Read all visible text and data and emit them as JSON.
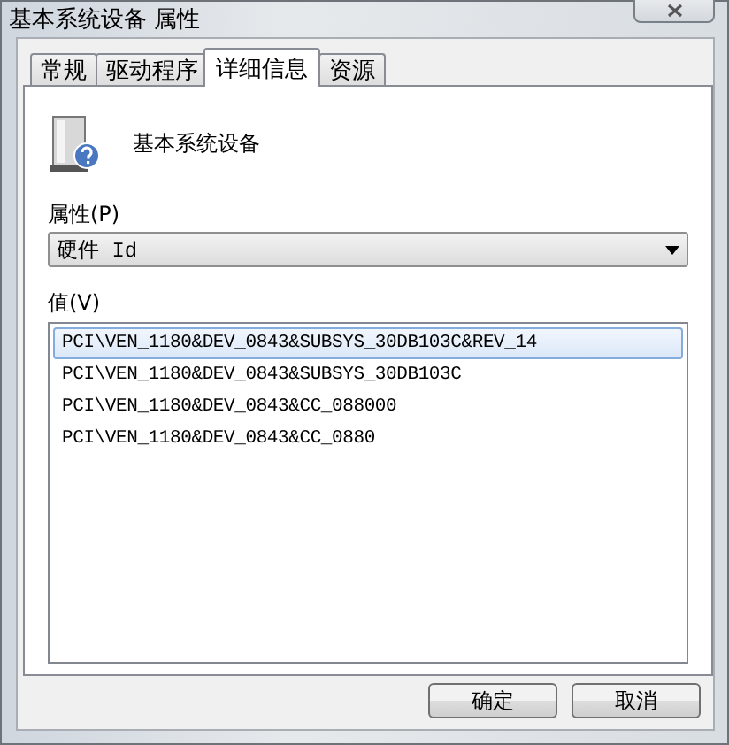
{
  "window": {
    "title": "基本系统设备 属性"
  },
  "tabs": [
    {
      "label": "常规",
      "selected": false
    },
    {
      "label": "驱动程序",
      "selected": false
    },
    {
      "label": "详细信息",
      "selected": true
    },
    {
      "label": "资源",
      "selected": false
    }
  ],
  "device": {
    "name": "基本系统设备"
  },
  "property": {
    "label": "属性(P)",
    "value": "硬件 Id"
  },
  "values": {
    "label": "值(V)",
    "items": [
      {
        "text": "PCI\\VEN_1180&DEV_0843&SUBSYS_30DB103C&REV_14",
        "selected": true
      },
      {
        "text": "PCI\\VEN_1180&DEV_0843&SUBSYS_30DB103C",
        "selected": false
      },
      {
        "text": "PCI\\VEN_1180&DEV_0843&CC_088000",
        "selected": false
      },
      {
        "text": "PCI\\VEN_1180&DEV_0843&CC_0880",
        "selected": false
      }
    ]
  },
  "buttons": [
    "确定",
    "取消"
  ]
}
